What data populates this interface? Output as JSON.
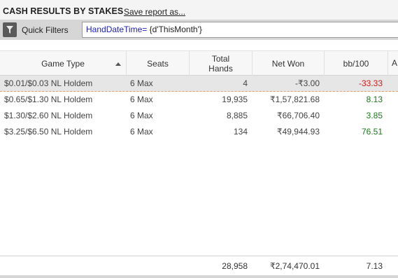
{
  "header": {
    "title": "CASH RESULTS BY STAKES",
    "save_link": "Save report as..."
  },
  "filter": {
    "icon": "funnel-icon",
    "label": "Quick Filters",
    "keyword": "HandDateTime=",
    "value": " {d'ThisMonth'}"
  },
  "columns": {
    "game_type": "Game Type",
    "seats": "Seats",
    "total_hands_line1": "Total",
    "total_hands_line2": "Hands",
    "net_won": "Net Won",
    "bb100": "bb/100",
    "extra": "A"
  },
  "rows": [
    {
      "game": "$0.01/$0.03 NL Holdem",
      "seats": "6 Max",
      "hands": "4",
      "net": "-₹3.00",
      "bb": "-33.33",
      "bb_sign": "neg"
    },
    {
      "game": "$0.65/$1.30 NL Holdem",
      "seats": "6 Max",
      "hands": "19,935",
      "net": "₹1,57,821.68",
      "bb": "8.13",
      "bb_sign": "pos"
    },
    {
      "game": "$1.30/$2.60 NL Holdem",
      "seats": "6 Max",
      "hands": "8,885",
      "net": "₹66,706.40",
      "bb": "3.85",
      "bb_sign": "pos"
    },
    {
      "game": "$3.25/$6.50 NL Holdem",
      "seats": "6 Max",
      "hands": "134",
      "net": "₹49,944.93",
      "bb": "76.51",
      "bb_sign": "pos"
    }
  ],
  "totals": {
    "hands": "28,958",
    "net": "₹2,74,470.01",
    "bb": "7.13"
  },
  "colors": {
    "negative": "#d11a1a",
    "positive": "#1a7a1a",
    "filter_keyword": "#1d1dbf"
  }
}
